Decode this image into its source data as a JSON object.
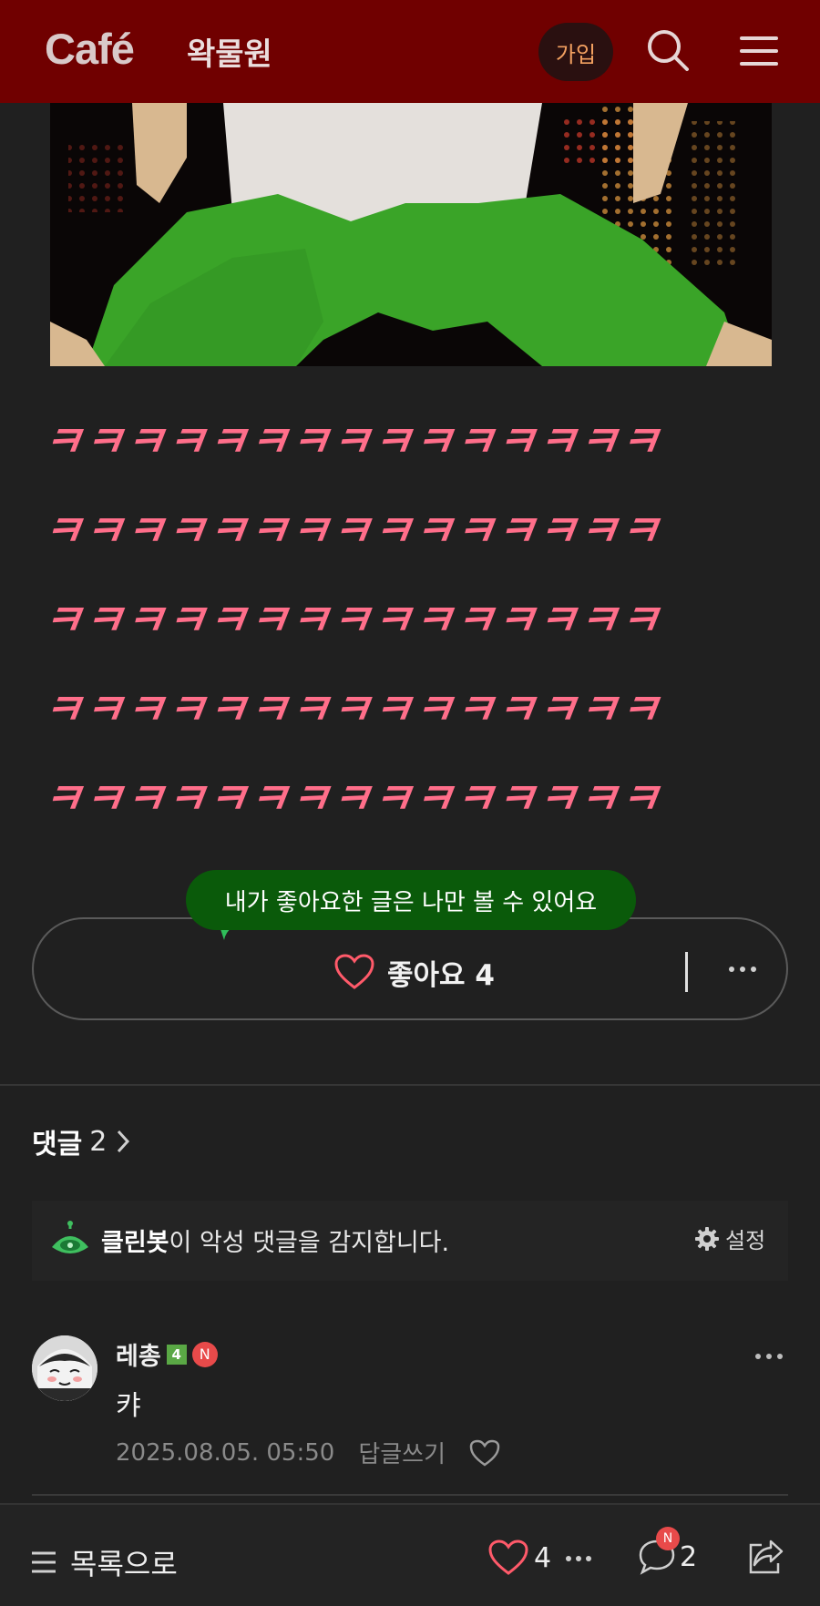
{
  "header": {
    "logo": "Café",
    "cafe_name": "왁물원",
    "join_label": "가입"
  },
  "post": {
    "laugh_lines": [
      "ㅋㅋㅋㅋㅋㅋㅋㅋㅋㅋㅋㅋㅋㅋㅋ",
      "ㅋㅋㅋㅋㅋㅋㅋㅋㅋㅋㅋㅋㅋㅋㅋ",
      "ㅋㅋㅋㅋㅋㅋㅋㅋㅋㅋㅋㅋㅋㅋㅋ",
      "ㅋㅋㅋㅋㅋㅋㅋㅋㅋㅋㅋㅋㅋㅋㅋ",
      "ㅋㅋㅋㅋㅋㅋㅋㅋㅋㅋㅋㅋㅋㅋㅋ"
    ],
    "laugh_color": "#ff6e8a"
  },
  "like_tooltip": "내가 좋아요한 글은 나만 볼 수 있어요",
  "like_bar": {
    "label": "좋아요 4"
  },
  "comments": {
    "title": "댓글",
    "count": "2",
    "cleanbot_name": "클린봇",
    "cleanbot_message": "이 악성 댓글을 감지합니다.",
    "settings_label": "설정",
    "items": [
      {
        "author": "레총",
        "level": "4",
        "new_badge": "N",
        "text": "캬",
        "date": "2025.08.05. 05:50",
        "reply_label": "답글쓰기"
      }
    ]
  },
  "bottom_bar": {
    "list_label": "목록으로",
    "like_count": "4",
    "comment_count": "2",
    "comment_new_badge": "N"
  },
  "colors": {
    "header_bg": "#700000",
    "page_bg": "#202020",
    "join_text": "#f2a060",
    "tooltip_bg": "#0a5a0a",
    "heart": "#ff5a6a"
  }
}
